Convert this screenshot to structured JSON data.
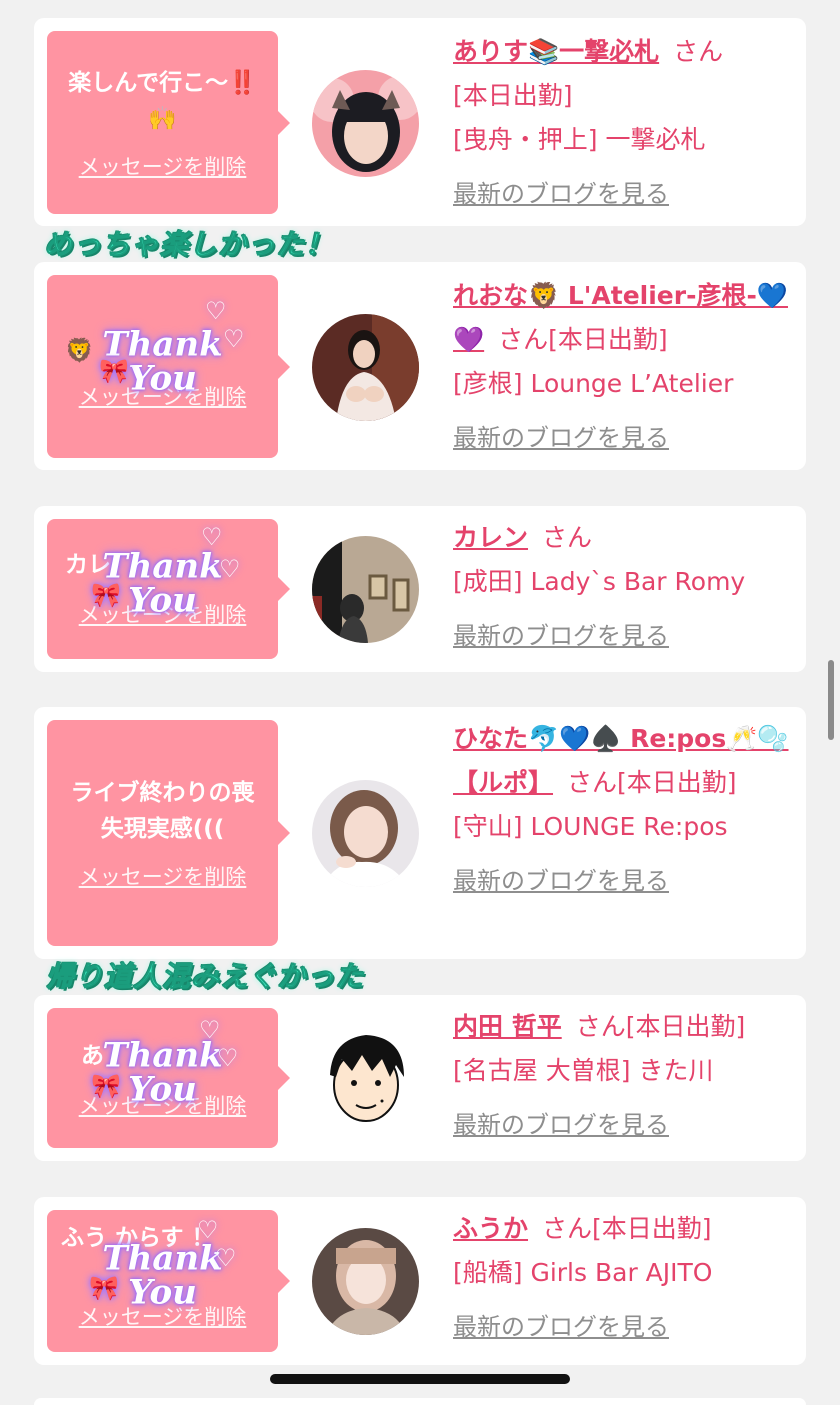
{
  "delete_label": "メッセージを削除",
  "blog_label": "最新のブログを見る",
  "san_label": "さん",
  "cards": [
    {
      "message": "楽しんで行こ〜‼️\n🙌",
      "name": "ありす📚一撃必札",
      "status": "[本日出勤]",
      "location": "[曳舟・押上] 一撃必札",
      "sticker": ""
    },
    {
      "message": "🦁",
      "name": "れおな🦁 L'Atelier-彦根-💙💜",
      "status": "[本日出勤]",
      "location": "[彦根] Lounge L’Atelier",
      "sticker": "Thank\nYou"
    },
    {
      "message": "カレ",
      "name": "カレン",
      "status": "",
      "location": "[成田] Lady`s Bar Romy",
      "sticker": "Thank\nYou"
    },
    {
      "message": "ライブ終わりの喪\n失現実感(((",
      "name": "ひなた🐬💙♠️ Re:pos🥂🫧【ルポ】",
      "status": "[本日出勤]",
      "location": "[守山] LOUNGE Re:pos",
      "sticker": ""
    },
    {
      "message": "あ",
      "name": "内田 哲平",
      "status": "[本日出勤]",
      "location": "[名古屋 大曽根] きた川",
      "sticker": "Thank\nYou"
    },
    {
      "message": "ふう  からす  ！",
      "name": "ふうか",
      "status": "[本日出勤]",
      "location": "[船橋] Girls Bar AJITO",
      "sticker": "Thank\nYou"
    }
  ],
  "comments": [
    "めっちゃ楽しかった！",
    "帰り道人混みえぐかった"
  ],
  "colors": {
    "accent": "#e4436b",
    "bubble": "#ff94a2",
    "comment": "#3ef0c4"
  }
}
